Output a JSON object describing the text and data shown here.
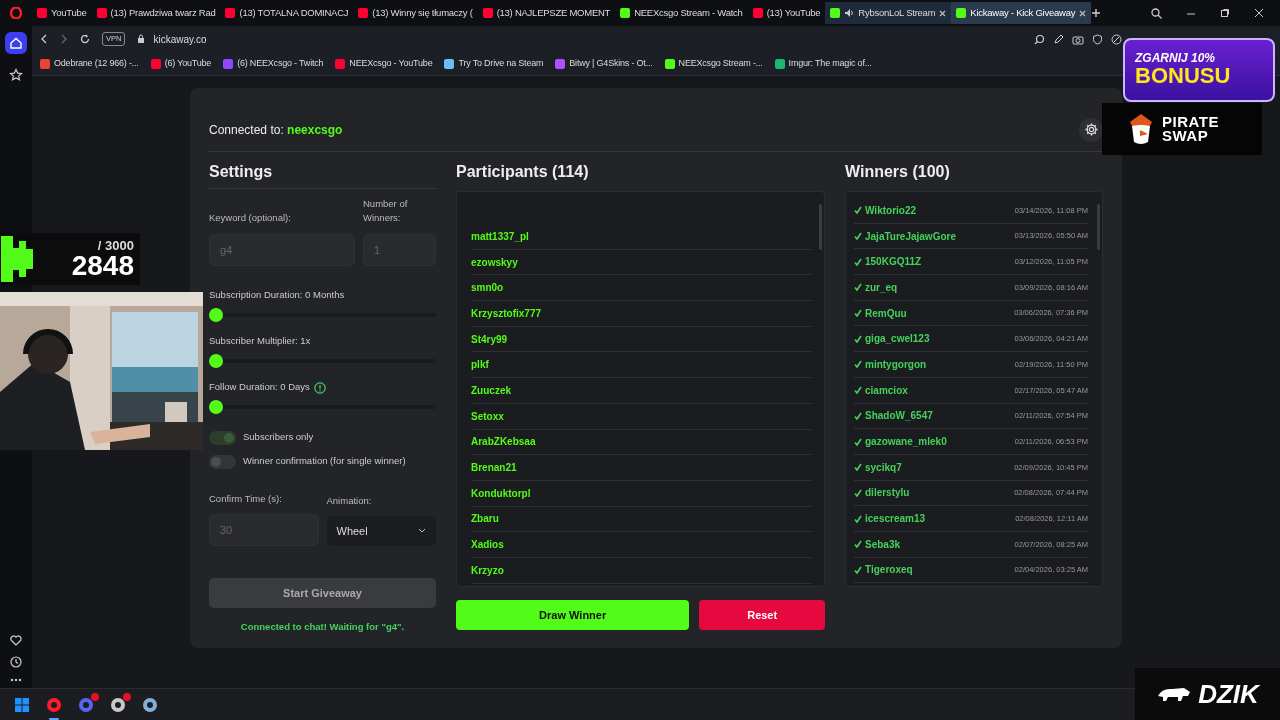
{
  "browser": {
    "tabs": [
      {
        "title": "YouTube",
        "color": "#ff0033",
        "selected": false,
        "audio": false,
        "group": false
      },
      {
        "title": "(13) Prawdziwa twarz Rad",
        "color": "#ff0033",
        "selected": false,
        "audio": false,
        "group": false
      },
      {
        "title": "(13) TOTALNA DOMINACJ",
        "color": "#ff0033",
        "selected": false,
        "audio": false,
        "group": false
      },
      {
        "title": "(13) Winny się tłumaczy (",
        "color": "#ff0033",
        "selected": false,
        "audio": false,
        "group": false
      },
      {
        "title": "(13) NAJLEPSZE MOMENT",
        "color": "#ff0033",
        "selected": false,
        "audio": false,
        "group": false
      },
      {
        "title": "NEEXcsgo Stream - Watch",
        "color": "#53fc18",
        "selected": false,
        "audio": false,
        "group": false
      },
      {
        "title": "(13) YouTube",
        "color": "#ff0033",
        "selected": false,
        "audio": false,
        "group": false
      },
      {
        "title": "RybsonLoL Stream",
        "color": "#53fc18",
        "selected": false,
        "audio": true,
        "group": true
      },
      {
        "title": "Kickaway - Kick Giveaway",
        "color": "#53fc18",
        "selected": true,
        "audio": false,
        "group": true
      }
    ],
    "sidebar": [
      {
        "selected": true
      },
      {
        "selected": false
      }
    ],
    "vpn": "VPN",
    "url": "kickaway.co",
    "bookmarks": [
      {
        "label": "Odebrane (12 966) -...",
        "color": "#ea4335"
      },
      {
        "label": "(6) YouTube",
        "color": "#ff0033"
      },
      {
        "label": "(6) NEEXcsgo - Twitch",
        "color": "#9146ff"
      },
      {
        "label": "NEEXcsgo - YouTube",
        "color": "#ff0033"
      },
      {
        "label": "Try To Drive na Steam",
        "color": "#66c0f4"
      },
      {
        "label": "Bitwy | G4Skins - Ot...",
        "color": "#a855f7"
      },
      {
        "label": "NEEXcsgo Stream -...",
        "color": "#53fc18"
      },
      {
        "label": "Imgur: The magic of...",
        "color": "#1bb76e"
      }
    ]
  },
  "app": {
    "connected_label": "Connected to:",
    "channel": "neexcsgo",
    "settings": {
      "title": "Settings",
      "keyword": {
        "label": "Keyword (optional):",
        "value": "g4",
        "disabled": true
      },
      "winners_count": {
        "label": "Number of Winners:",
        "value": "1",
        "disabled": true
      },
      "sliders": [
        {
          "label": "Subscription Duration: 0 Months",
          "level": 0,
          "hint": false
        },
        {
          "label": "Subscriber Multiplier: 1x",
          "level": 0,
          "hint": false
        },
        {
          "label": "Follow Duration:  0  Days",
          "level": 0,
          "hint": true
        }
      ],
      "toggles": [
        {
          "label": "Subscribers only",
          "on": true
        },
        {
          "label": "Winner confirmation (for single winner)",
          "on": false
        }
      ],
      "confirm_time": {
        "label": "Confirm Time (s):",
        "value": "30",
        "disabled": true
      },
      "animation": {
        "label": "Animation:",
        "value": "Wheel"
      },
      "start_button": {
        "label": "Start Giveaway",
        "disabled": true
      },
      "status": "Connected to chat! Waiting for \"g4\"."
    },
    "participants": {
      "title": "Participants (114)",
      "items": [
        "matt1337_pl",
        "ezowskyy",
        "smn0o",
        "Krzysztofix777",
        "St4ry99",
        "plkf",
        "Zuuczek",
        "Setoxx",
        "ArabZKebsaa",
        "Brenan21",
        "Konduktorpl",
        "Zbaru",
        "Xadios",
        "Krzyzo"
      ]
    },
    "draw_button": "Draw Winner",
    "reset_button": "Reset",
    "winners": {
      "title": "Winners (100)",
      "items": [
        {
          "name": "Wiktorio22",
          "time": "03/14/2026, 11:08 PM"
        },
        {
          "name": "JajaTureJajawGore",
          "time": "03/13/2026, 05:50 AM"
        },
        {
          "name": "150KGQ11Z",
          "time": "03/12/2026, 11:05 PM"
        },
        {
          "name": "zur_eq",
          "time": "03/09/2026, 08:16 AM"
        },
        {
          "name": "RemQuu",
          "time": "03/06/2026, 07:36 PM"
        },
        {
          "name": "giga_cwel123",
          "time": "03/06/2026, 04:21 AM"
        },
        {
          "name": "mintygorgon",
          "time": "02/19/2026, 11:50 PM"
        },
        {
          "name": "ciamciox",
          "time": "02/17/2026, 05:47 AM"
        },
        {
          "name": "ShadoW_6547",
          "time": "02/11/2026, 07:54 PM"
        },
        {
          "name": "gazowane_mlek0",
          "time": "02/11/2026, 06:53 PM"
        },
        {
          "name": "sycikq7",
          "time": "02/09/2026, 10:45 PM"
        },
        {
          "name": "dilerstylu",
          "time": "02/08/2026, 07:44 PM"
        },
        {
          "name": "icescream13",
          "time": "02/08/2026, 12:11 AM"
        },
        {
          "name": "Seba3k",
          "time": "02/07/2026, 08:25 AM"
        },
        {
          "name": "Tigeroxeq",
          "time": "02/04/2026, 03:25 AM"
        }
      ]
    }
  },
  "overlays": {
    "counter": {
      "goal": "/ 3000",
      "count": "2848"
    },
    "promo": {
      "line1": "ZGARNIJ 10%",
      "line2": "BONUSU"
    },
    "sponsor": {
      "line1": "PIRATE",
      "line2": "SWAP"
    },
    "brand": "DZIK"
  },
  "taskbar": [
    {
      "kind": "start",
      "color": "#1e90ff",
      "active": false,
      "notification": false
    },
    {
      "kind": "app",
      "color": "#ff1b2d",
      "active": true,
      "notification": false
    },
    {
      "kind": "app",
      "color": "#5865f2",
      "active": false,
      "notification": true
    },
    {
      "kind": "app",
      "color": "#c8c8c8",
      "active": false,
      "notification": true
    },
    {
      "kind": "app",
      "color": "#7fb0d8",
      "active": false,
      "notification": false
    }
  ]
}
